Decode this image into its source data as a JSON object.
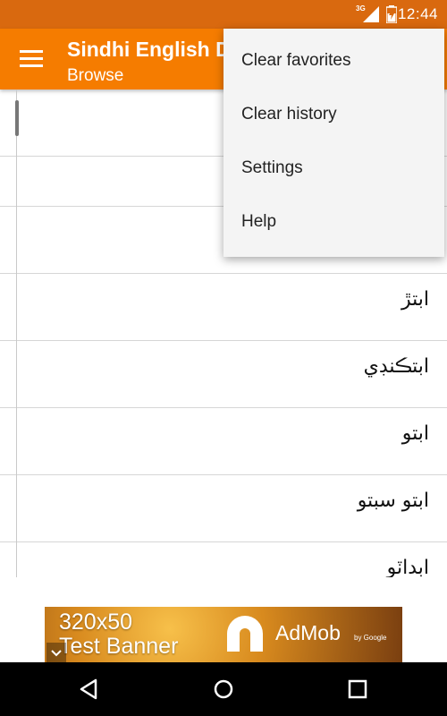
{
  "status_bar": {
    "time": "12:44",
    "network": "3G"
  },
  "app_bar": {
    "title": "Sindhi English Dictionary",
    "subtitle": "Browse"
  },
  "list": {
    "items": [
      {
        "word": ""
      },
      {
        "word": ""
      },
      {
        "word": ""
      },
      {
        "word": "ابتڙ"
      },
      {
        "word": "ابتڪنڊي"
      },
      {
        "word": "ابتو"
      },
      {
        "word": "ابتو سبتو"
      },
      {
        "word": "ابداٽو"
      }
    ]
  },
  "overflow_menu": {
    "items": [
      {
        "label": "Clear favorites"
      },
      {
        "label": "Clear history"
      },
      {
        "label": "Settings"
      },
      {
        "label": "Help"
      }
    ]
  },
  "ad": {
    "line1": "320x50",
    "line2": "Test Banner",
    "brand": "AdMob",
    "by": "by Google"
  },
  "colors": {
    "status_bar": "#d9690f",
    "app_bar": "#f57c00"
  }
}
